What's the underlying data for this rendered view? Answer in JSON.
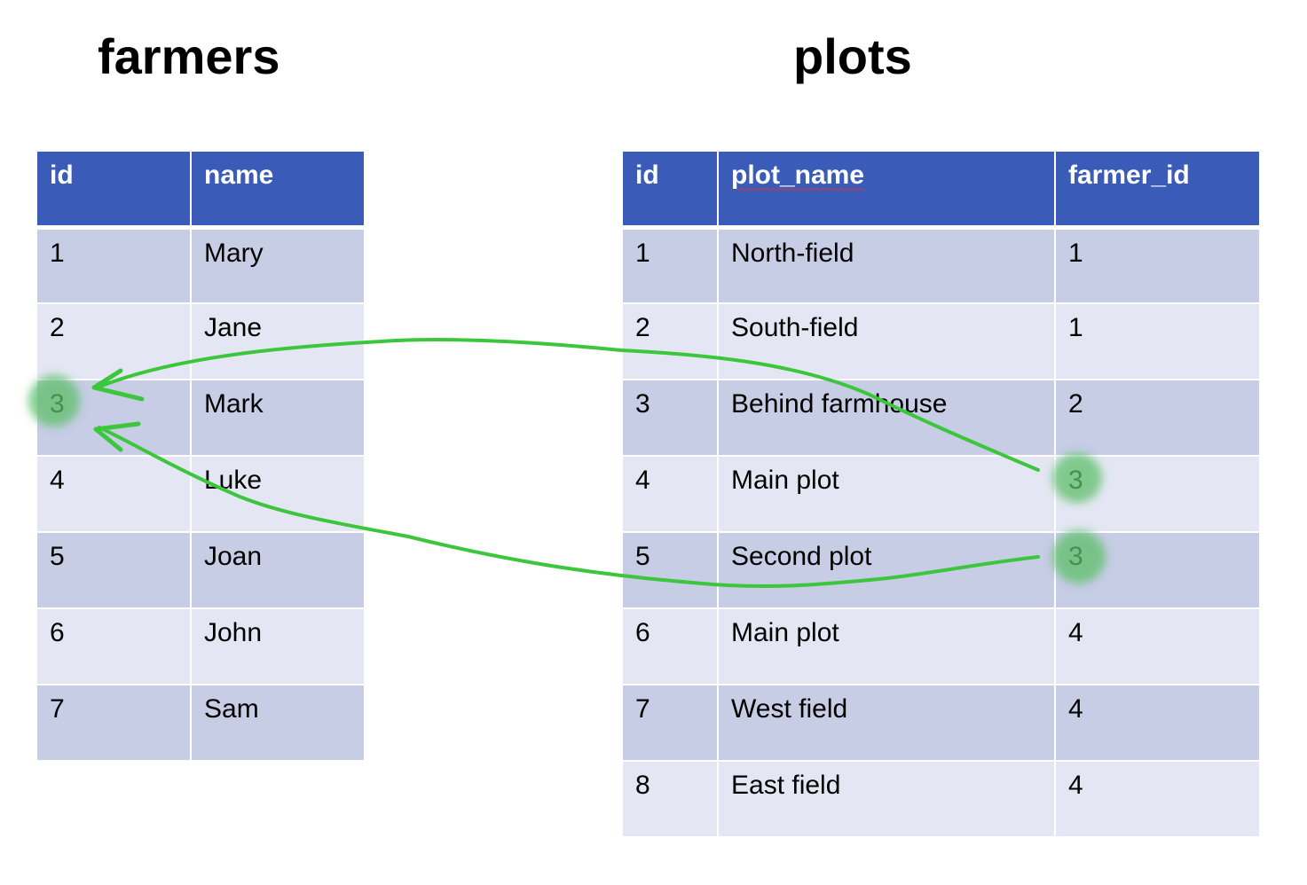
{
  "farmers": {
    "title": "farmers",
    "columns": [
      "id",
      "name"
    ],
    "rows": [
      [
        "1",
        "Mary"
      ],
      [
        "2",
        "Jane"
      ],
      [
        "3",
        "Mark"
      ],
      [
        "4",
        "Luke"
      ],
      [
        "5",
        "Joan"
      ],
      [
        "6",
        "John"
      ],
      [
        "7",
        "Sam"
      ]
    ]
  },
  "plots": {
    "title": "plots",
    "columns": [
      "id",
      "plot_name",
      "farmer_id"
    ],
    "rows": [
      [
        "1",
        "North-field",
        "1"
      ],
      [
        "2",
        "South-field",
        "1"
      ],
      [
        "3",
        "Behind farmhouse",
        "2"
      ],
      [
        "4",
        "Main plot",
        "3"
      ],
      [
        "5",
        "Second plot",
        "3"
      ],
      [
        "6",
        "Main plot",
        "4"
      ],
      [
        "7",
        "West field",
        "4"
      ],
      [
        "8",
        "East field",
        "4"
      ]
    ]
  },
  "annotations": {
    "color": "#3cc63c",
    "highlight_color": "#5fbf6a",
    "links": [
      {
        "from_table": "plots",
        "from_row_id": "4",
        "to_table": "farmers",
        "to_row_id": "3"
      },
      {
        "from_table": "plots",
        "from_row_id": "5",
        "to_table": "farmers",
        "to_row_id": "3"
      }
    ]
  },
  "colors": {
    "header_bg": "#3a5cb8",
    "row_dark": "#c6cde5",
    "row_light": "#e4e7f3"
  }
}
